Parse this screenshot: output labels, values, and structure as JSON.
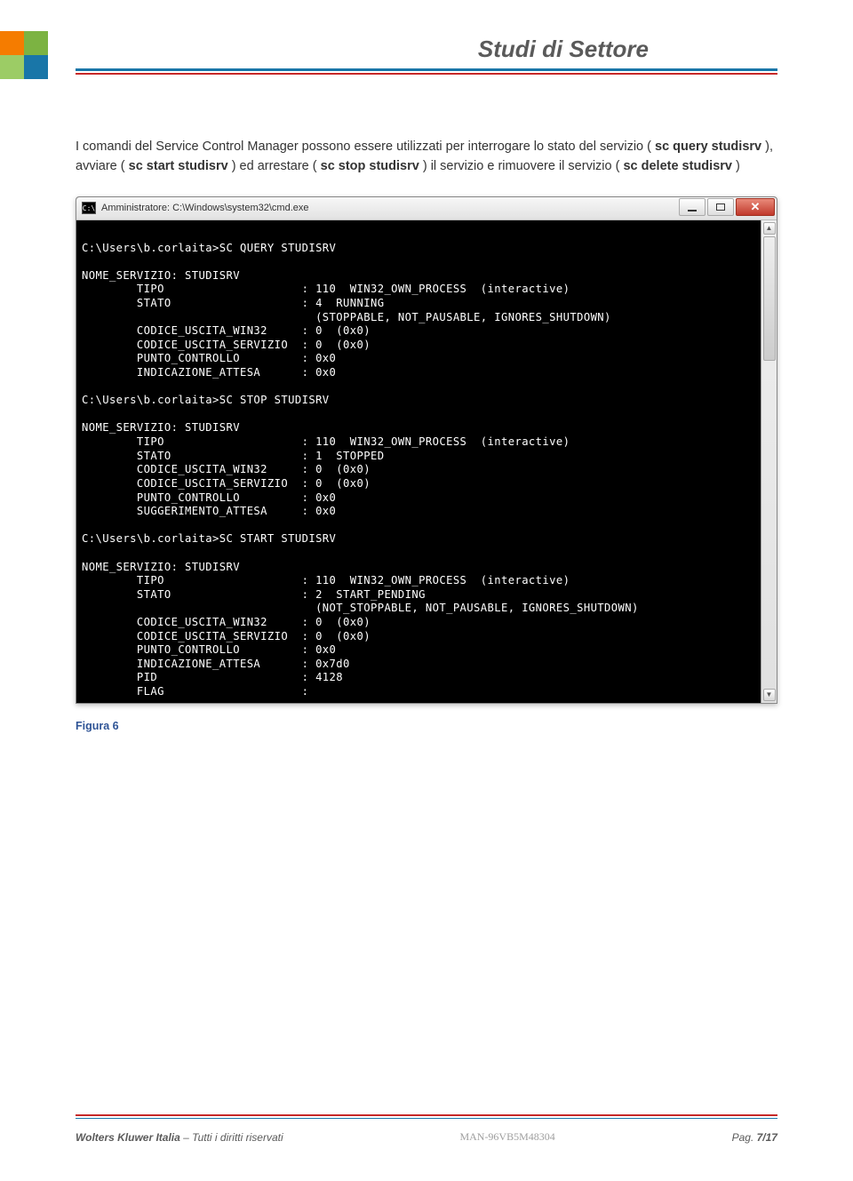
{
  "header": {
    "title": "Studi di Settore"
  },
  "body": {
    "p1a": "I comandi del Service Control Manager possono essere utilizzati per interrogare lo stato del servizio ( ",
    "b1": "sc query studisrv",
    "p1b": " ), avviare ( ",
    "b2": "sc start studisrv",
    "p1c": " ) ed arrestare ( ",
    "b3": "sc stop studisrv",
    "p1d": " ) il servizio e rimuovere il servizio ( ",
    "b4": "sc delete studisrv",
    "p1e": " )"
  },
  "cmd": {
    "title": "Amministratore: C:\\Windows\\system32\\cmd.exe",
    "content": "\nC:\\Users\\b.corlaita>SC QUERY STUDISRV\n\nNOME_SERVIZIO: STUDISRV\n        TIPO                    : 110  WIN32_OWN_PROCESS  (interactive)\n        STATO                   : 4  RUNNING\n                                  (STOPPABLE, NOT_PAUSABLE, IGNORES_SHUTDOWN)\n        CODICE_USCITA_WIN32     : 0  (0x0)\n        CODICE_USCITA_SERVIZIO  : 0  (0x0)\n        PUNTO_CONTROLLO         : 0x0\n        INDICAZIONE_ATTESA      : 0x0\n\nC:\\Users\\b.corlaita>SC STOP STUDISRV\n\nNOME_SERVIZIO: STUDISRV\n        TIPO                    : 110  WIN32_OWN_PROCESS  (interactive)\n        STATO                   : 1  STOPPED\n        CODICE_USCITA_WIN32     : 0  (0x0)\n        CODICE_USCITA_SERVIZIO  : 0  (0x0)\n        PUNTO_CONTROLLO         : 0x0\n        SUGGERIMENTO_ATTESA     : 0x0\n\nC:\\Users\\b.corlaita>SC START STUDISRV\n\nNOME_SERVIZIO: STUDISRV\n        TIPO                    : 110  WIN32_OWN_PROCESS  (interactive)\n        STATO                   : 2  START_PENDING\n                                  (NOT_STOPPABLE, NOT_PAUSABLE, IGNORES_SHUTDOWN)\n        CODICE_USCITA_WIN32     : 0  (0x0)\n        CODICE_USCITA_SERVIZIO  : 0  (0x0)\n        PUNTO_CONTROLLO         : 0x0\n        INDICAZIONE_ATTESA      : 0x7d0\n        PID                     : 4128\n        FLAG                    :"
  },
  "caption": "Figura 6",
  "footer": {
    "left_bold": "Wolters Kluwer Italia",
    "left_rest": " – Tutti i diritti riservati",
    "mid": "MAN-96VB5M48304",
    "right_label": "Pag. ",
    "right_page": "7/17"
  }
}
